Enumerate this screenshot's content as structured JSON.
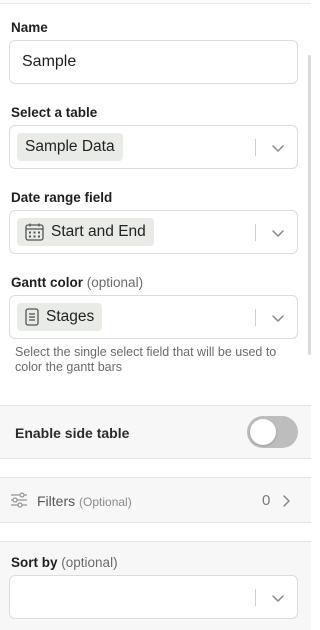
{
  "name": {
    "label": "Name",
    "value": "Sample"
  },
  "table": {
    "label": "Select a table",
    "selected": "Sample Data"
  },
  "date_range": {
    "label": "Date range field",
    "selected": "Start and End",
    "icon": "calendar-icon"
  },
  "gantt_color": {
    "label": "Gantt color",
    "optional_label": "(optional)",
    "selected": "Stages",
    "icon": "single-select-icon",
    "helper": "Select the single select field that will be used to color the gantt bars"
  },
  "side_table": {
    "label": "Enable side table",
    "enabled": false
  },
  "filters": {
    "label": "Filters",
    "optional_label": "(Optional)",
    "count": "0"
  },
  "sort_by": {
    "label": "Sort by",
    "optional_label": "(optional)",
    "value": ""
  }
}
